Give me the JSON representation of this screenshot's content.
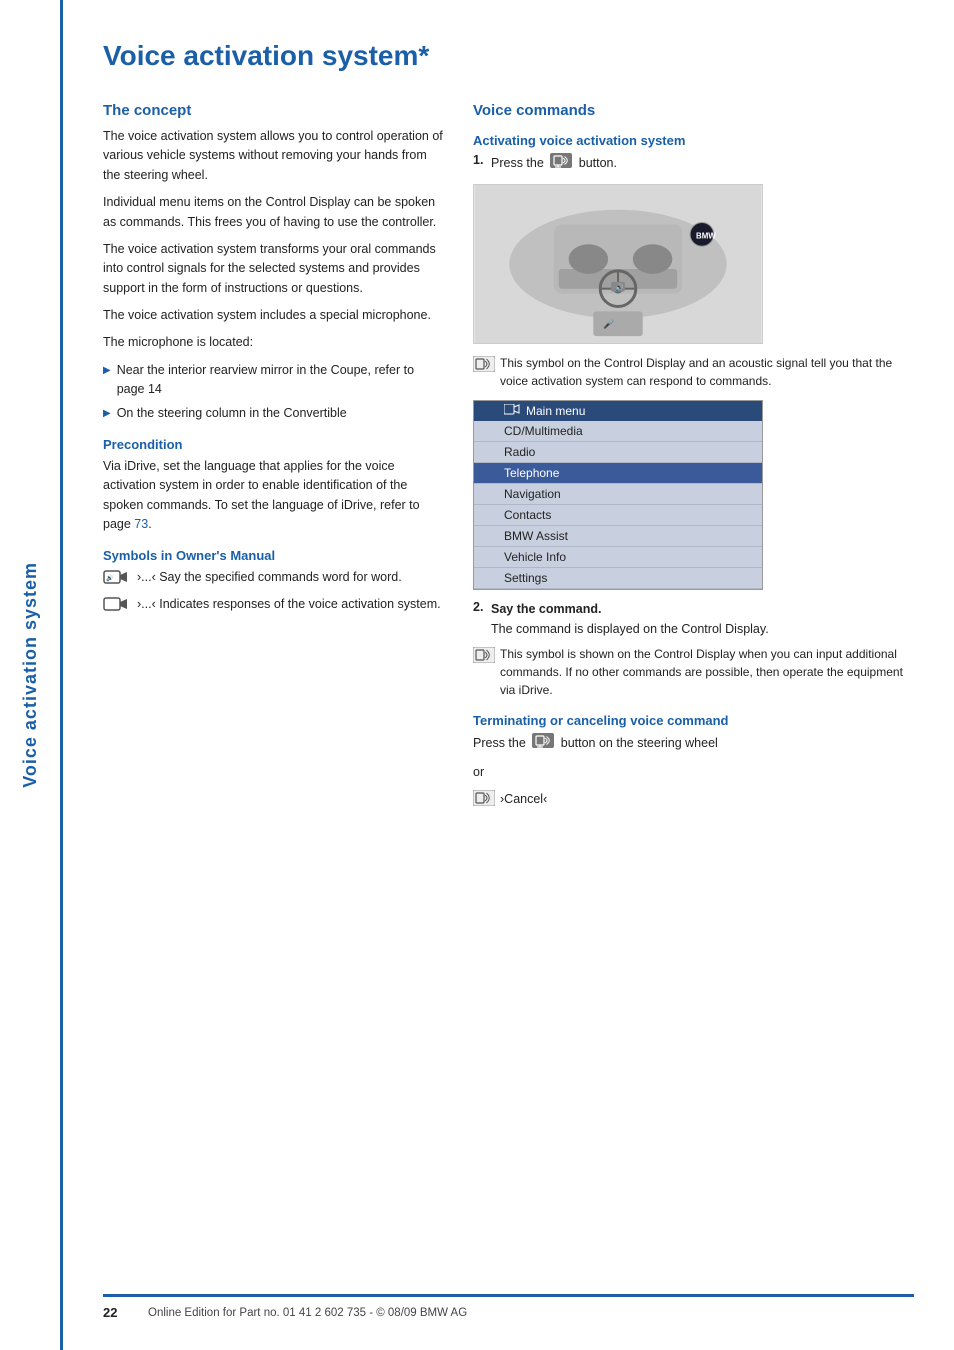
{
  "page": {
    "title": "Voice activation system*",
    "sidebar_label": "Voice activation system",
    "page_number": "22",
    "footer_text": "Online Edition for Part no. 01 41 2 602 735 - © 08/09 BMW AG"
  },
  "left_column": {
    "section_title": "The concept",
    "intro_paragraphs": [
      "The voice activation system allows you to control operation of various vehicle systems without removing your hands from the steering wheel.",
      "Individual menu items on the Control Display can be spoken as commands. This frees you of having to use the controller.",
      "The voice activation system transforms your oral commands into control signals for the selected systems and provides support in the form of instructions or questions.",
      "The voice activation system includes a special microphone."
    ],
    "microphone_label": "The microphone is located:",
    "bullet_items": [
      "Near the interior rearview mirror in the Coupe, refer to page 14",
      "On the steering column in the Convertible"
    ],
    "precondition_heading": "Precondition",
    "precondition_text": "Via iDrive, set the language that applies for the voice activation system in order to enable identification of the spoken commands. To set the language of iDrive, refer to page 73.",
    "symbols_heading": "Symbols in Owner's Manual",
    "symbol_1_text": "›...‹ Say the specified commands word for word.",
    "symbol_2_text": "›...‹ Indicates responses of the voice activation system."
  },
  "right_column": {
    "section_title": "Voice commands",
    "activating_heading": "Activating voice activation system",
    "step1_text": "Press the",
    "step1_suffix": "button.",
    "caption_text": "This symbol on the Control Display and an acoustic signal tell you that the voice activation system can respond to commands.",
    "step2_number": "2.",
    "step2_text": "Say the command.",
    "step2_detail": "The command is displayed on the Control Display.",
    "step2_caption": "This symbol is shown on the Control Display when you can input additional commands. If no other commands are possible, then operate the equipment via iDrive.",
    "terminating_heading": "Terminating or canceling voice command",
    "terminating_text": "Press the",
    "terminating_suffix": "button on the steering wheel",
    "terminating_or": "or",
    "cancel_command": "›Cancel‹",
    "menu": {
      "header": "Main menu",
      "items": [
        {
          "label": "CD/Multimedia",
          "highlighted": false
        },
        {
          "label": "Radio",
          "highlighted": false
        },
        {
          "label": "Telephone",
          "highlighted": true
        },
        {
          "label": "Navigation",
          "highlighted": false
        },
        {
          "label": "Contacts",
          "highlighted": false
        },
        {
          "label": "BMW Assist",
          "highlighted": false
        },
        {
          "label": "Vehicle Info",
          "highlighted": false
        },
        {
          "label": "Settings",
          "highlighted": false
        }
      ]
    }
  }
}
